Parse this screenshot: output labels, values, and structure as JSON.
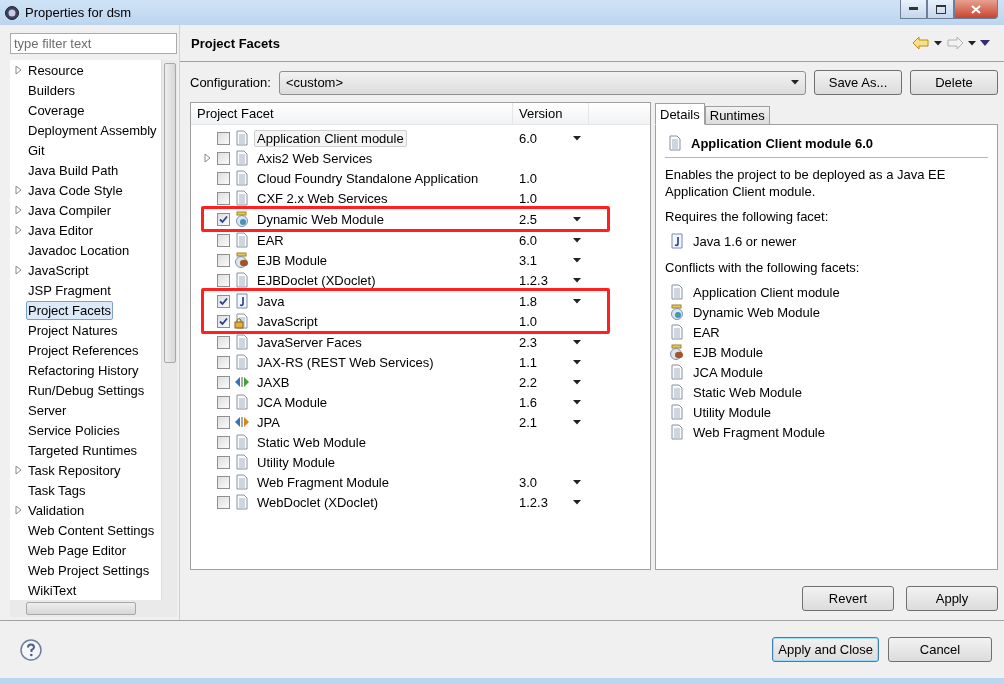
{
  "window": {
    "title": "Properties for dsm"
  },
  "filter": {
    "placeholder": "type filter text"
  },
  "nav_items": [
    {
      "label": "Resource",
      "expandable": true,
      "selected": false
    },
    {
      "label": "Builders",
      "expandable": false,
      "selected": false
    },
    {
      "label": "Coverage",
      "expandable": false,
      "selected": false
    },
    {
      "label": "Deployment Assembly",
      "expandable": false,
      "selected": false
    },
    {
      "label": "Git",
      "expandable": false,
      "selected": false
    },
    {
      "label": "Java Build Path",
      "expandable": false,
      "selected": false
    },
    {
      "label": "Java Code Style",
      "expandable": true,
      "selected": false
    },
    {
      "label": "Java Compiler",
      "expandable": true,
      "selected": false
    },
    {
      "label": "Java Editor",
      "expandable": true,
      "selected": false
    },
    {
      "label": "Javadoc Location",
      "expandable": false,
      "selected": false
    },
    {
      "label": "JavaScript",
      "expandable": true,
      "selected": false
    },
    {
      "label": "JSP Fragment",
      "expandable": false,
      "selected": false
    },
    {
      "label": "Project Facets",
      "expandable": false,
      "selected": true
    },
    {
      "label": "Project Natures",
      "expandable": false,
      "selected": false
    },
    {
      "label": "Project References",
      "expandable": false,
      "selected": false
    },
    {
      "label": "Refactoring History",
      "expandable": false,
      "selected": false
    },
    {
      "label": "Run/Debug Settings",
      "expandable": false,
      "selected": false
    },
    {
      "label": "Server",
      "expandable": false,
      "selected": false
    },
    {
      "label": "Service Policies",
      "expandable": false,
      "selected": false
    },
    {
      "label": "Targeted Runtimes",
      "expandable": false,
      "selected": false
    },
    {
      "label": "Task Repository",
      "expandable": true,
      "selected": false
    },
    {
      "label": "Task Tags",
      "expandable": false,
      "selected": false
    },
    {
      "label": "Validation",
      "expandable": true,
      "selected": false
    },
    {
      "label": "Web Content Settings",
      "expandable": false,
      "selected": false
    },
    {
      "label": "Web Page Editor",
      "expandable": false,
      "selected": false
    },
    {
      "label": "Web Project Settings",
      "expandable": false,
      "selected": false
    },
    {
      "label": "WikiText",
      "expandable": false,
      "selected": false
    }
  ],
  "page": {
    "title": "Project Facets"
  },
  "configuration": {
    "label": "Configuration:",
    "value": "<custom>",
    "buttons": [
      "Save As...",
      "Delete"
    ]
  },
  "facets_table": {
    "columns": [
      "Project Facet",
      "Version"
    ],
    "rows": [
      {
        "name": "Application Client module",
        "version": "6.0",
        "kind": "doc",
        "checked": false,
        "dropdown": true,
        "expandable": false,
        "selected": true,
        "highlighted": false
      },
      {
        "name": "Axis2 Web Services",
        "version": "",
        "kind": "doc",
        "checked": false,
        "dropdown": false,
        "expandable": true,
        "selected": false,
        "highlighted": false
      },
      {
        "name": "Cloud Foundry Standalone Application",
        "version": "1.0",
        "kind": "doc",
        "checked": false,
        "dropdown": false,
        "expandable": false,
        "selected": false,
        "highlighted": false
      },
      {
        "name": "CXF 2.x Web Services",
        "version": "1.0",
        "kind": "doc",
        "checked": false,
        "dropdown": false,
        "expandable": false,
        "selected": false,
        "highlighted": false
      },
      {
        "name": "Dynamic Web Module",
        "version": "2.5",
        "kind": "globe",
        "checked": true,
        "dropdown": true,
        "expandable": false,
        "selected": false,
        "highlighted": true
      },
      {
        "name": "EAR",
        "version": "6.0",
        "kind": "doc",
        "checked": false,
        "dropdown": true,
        "expandable": false,
        "selected": false,
        "highlighted": false
      },
      {
        "name": "EJB Module",
        "version": "3.1",
        "kind": "bean",
        "checked": false,
        "dropdown": true,
        "expandable": false,
        "selected": false,
        "highlighted": false
      },
      {
        "name": "EJBDoclet (XDoclet)",
        "version": "1.2.3",
        "kind": "doc",
        "checked": false,
        "dropdown": true,
        "expandable": false,
        "selected": false,
        "highlighted": false
      },
      {
        "name": "Java",
        "version": "1.8",
        "kind": "java",
        "checked": true,
        "dropdown": true,
        "expandable": false,
        "selected": false,
        "highlighted": true
      },
      {
        "name": "JavaScript",
        "version": "1.0",
        "kind": "locked",
        "checked": true,
        "dropdown": false,
        "expandable": false,
        "selected": false,
        "highlighted": true
      },
      {
        "name": "JavaServer Faces",
        "version": "2.3",
        "kind": "doc",
        "checked": false,
        "dropdown": true,
        "expandable": false,
        "selected": false,
        "highlighted": false
      },
      {
        "name": "JAX-RS (REST Web Services)",
        "version": "1.1",
        "kind": "doc",
        "checked": false,
        "dropdown": true,
        "expandable": false,
        "selected": false,
        "highlighted": false
      },
      {
        "name": "JAXB",
        "version": "2.2",
        "kind": "arrows-green",
        "checked": false,
        "dropdown": true,
        "expandable": false,
        "selected": false,
        "highlighted": false
      },
      {
        "name": "JCA Module",
        "version": "1.6",
        "kind": "doc",
        "checked": false,
        "dropdown": true,
        "expandable": false,
        "selected": false,
        "highlighted": false
      },
      {
        "name": "JPA",
        "version": "2.1",
        "kind": "arrows-orange",
        "checked": false,
        "dropdown": true,
        "expandable": false,
        "selected": false,
        "highlighted": false
      },
      {
        "name": "Static Web Module",
        "version": "",
        "kind": "doc",
        "checked": false,
        "dropdown": false,
        "expandable": false,
        "selected": false,
        "highlighted": false
      },
      {
        "name": "Utility Module",
        "version": "",
        "kind": "doc",
        "checked": false,
        "dropdown": false,
        "expandable": false,
        "selected": false,
        "highlighted": false
      },
      {
        "name": "Web Fragment Module",
        "version": "3.0",
        "kind": "doc",
        "checked": false,
        "dropdown": true,
        "expandable": false,
        "selected": false,
        "highlighted": false
      },
      {
        "name": "WebDoclet (XDoclet)",
        "version": "1.2.3",
        "kind": "doc",
        "checked": false,
        "dropdown": true,
        "expandable": false,
        "selected": false,
        "highlighted": false
      }
    ]
  },
  "details": {
    "tabs": [
      {
        "label": "Details",
        "selected": true
      },
      {
        "label": "Runtimes",
        "selected": false
      }
    ],
    "heading": "Application Client module 6.0",
    "description": "Enables the project to be deployed as a Java EE Application Client module.",
    "requires_label": "Requires the following facet:",
    "requires": [
      {
        "label": "Java 1.6 or newer",
        "kind": "java"
      }
    ],
    "conflicts_label": "Conflicts with the following facets:",
    "conflicts": [
      {
        "label": "Application Client module",
        "kind": "doc"
      },
      {
        "label": "Dynamic Web Module",
        "kind": "globe"
      },
      {
        "label": "EAR",
        "kind": "doc"
      },
      {
        "label": "EJB Module",
        "kind": "bean"
      },
      {
        "label": "JCA Module",
        "kind": "doc"
      },
      {
        "label": "Static Web Module",
        "kind": "doc"
      },
      {
        "label": "Utility Module",
        "kind": "doc"
      },
      {
        "label": "Web Fragment Module",
        "kind": "doc"
      }
    ]
  },
  "page_buttons": [
    "Revert",
    "Apply"
  ],
  "dialog_buttons": [
    {
      "label": "Apply and Close",
      "default": true
    },
    {
      "label": "Cancel",
      "default": false
    }
  ]
}
